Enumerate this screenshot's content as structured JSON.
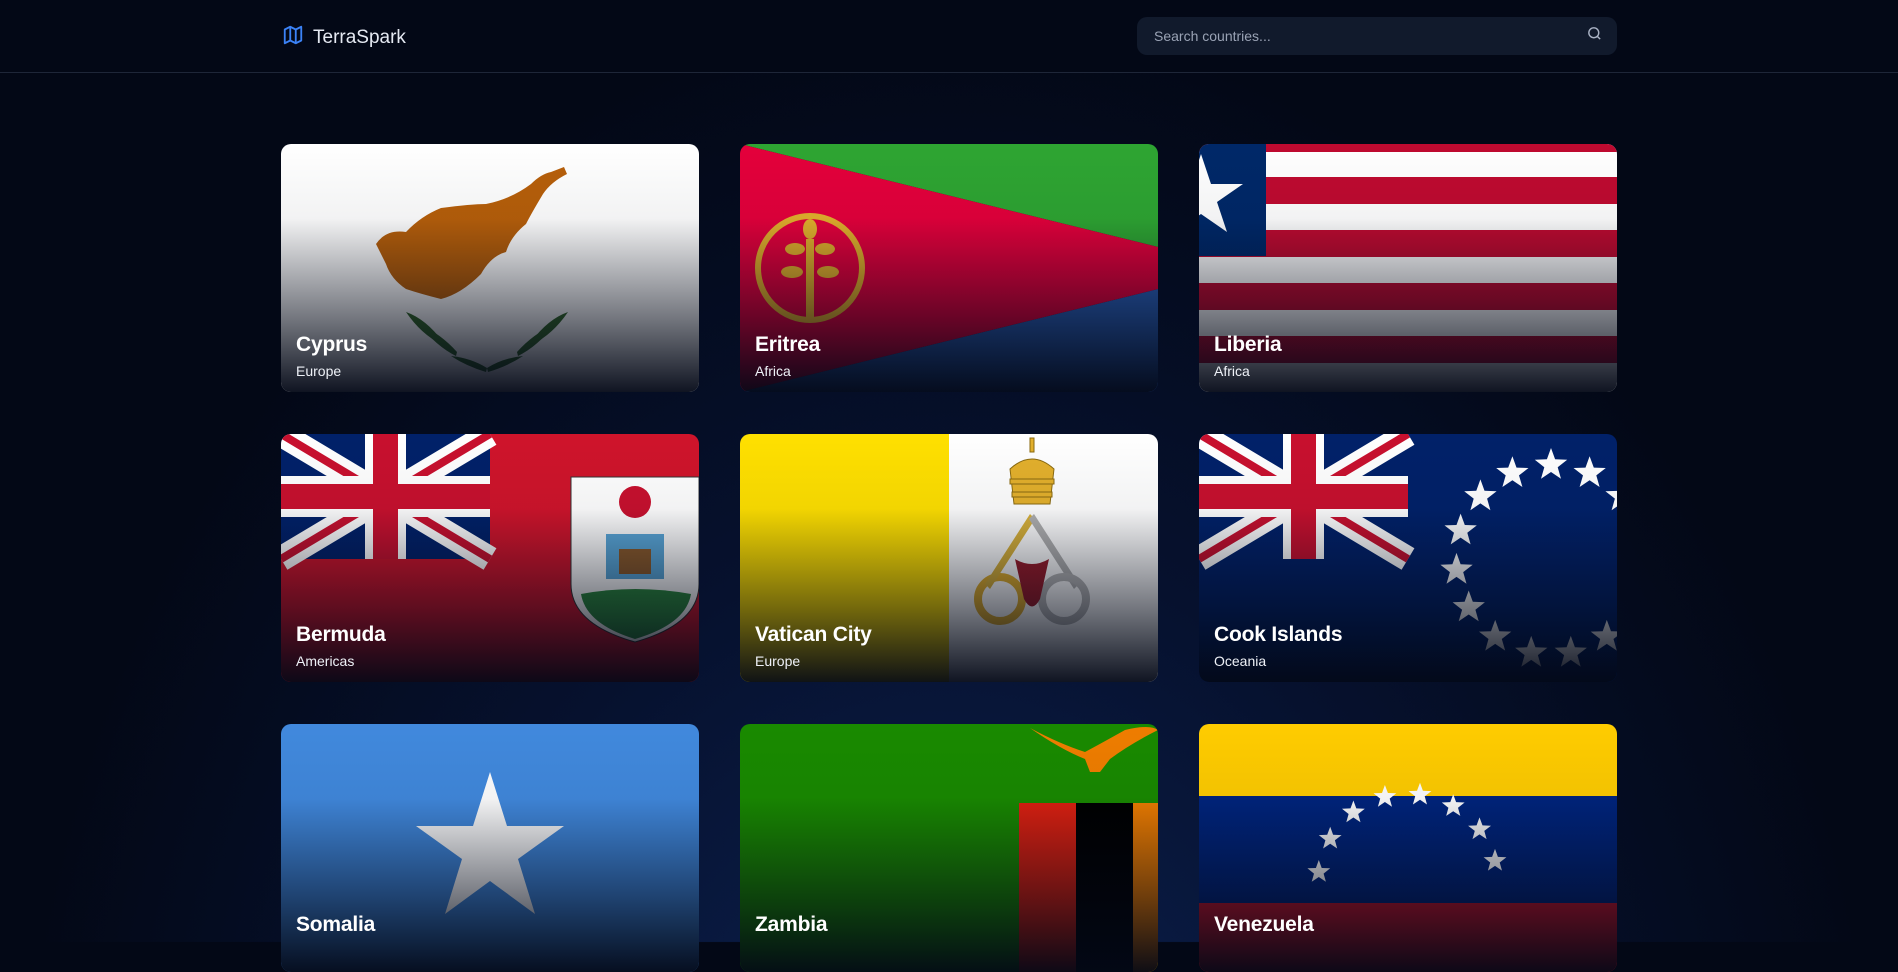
{
  "brand": {
    "name": "TerraSpark",
    "icon": "map-icon",
    "accent": "#3b82f6"
  },
  "search": {
    "placeholder": "Search countries..."
  },
  "countries": [
    {
      "name": "Cyprus",
      "region": "Europe"
    },
    {
      "name": "Eritrea",
      "region": "Africa"
    },
    {
      "name": "Liberia",
      "region": "Africa"
    },
    {
      "name": "Bermuda",
      "region": "Americas"
    },
    {
      "name": "Vatican City",
      "region": "Europe"
    },
    {
      "name": "Cook Islands",
      "region": "Oceania"
    },
    {
      "name": "Somalia",
      "region": ""
    },
    {
      "name": "Zambia",
      "region": ""
    },
    {
      "name": "Venezuela",
      "region": ""
    }
  ]
}
